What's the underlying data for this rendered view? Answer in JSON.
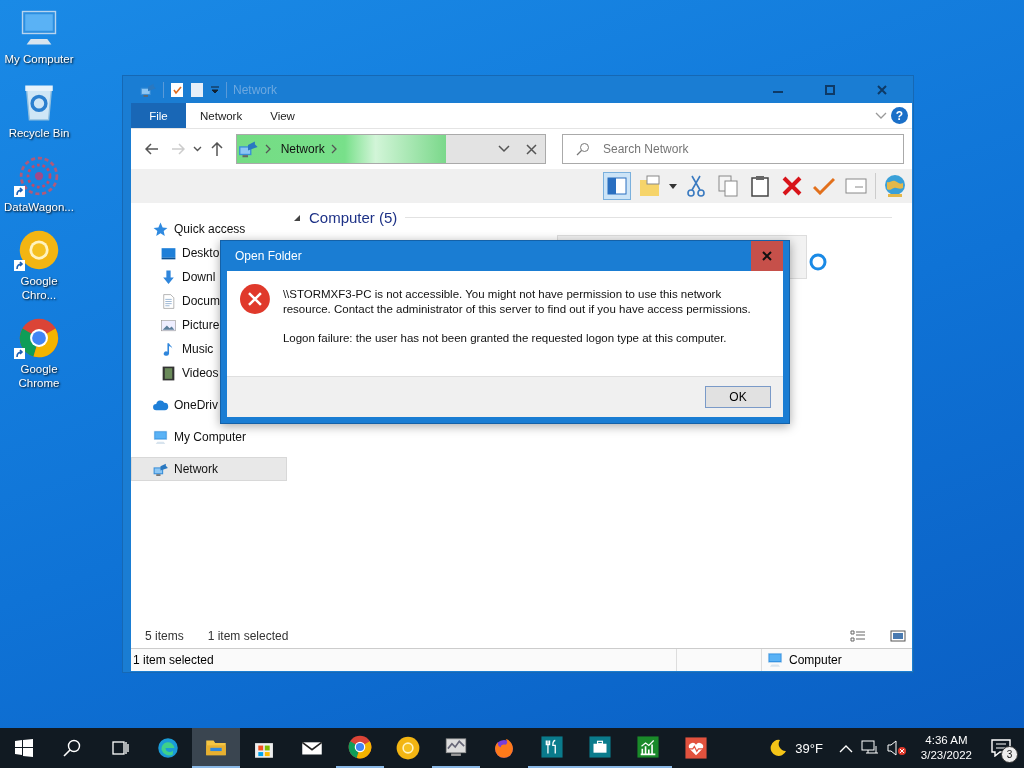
{
  "desktop_icons": [
    {
      "label": "My Computer",
      "kind": "computer",
      "shortcut": false
    },
    {
      "label": "Recycle Bin",
      "kind": "recycle",
      "shortcut": false
    },
    {
      "label": "DataWagon...",
      "kind": "datawagon",
      "shortcut": true
    },
    {
      "label": "Google Chro...",
      "kind": "canary",
      "shortcut": true
    },
    {
      "label": "Google Chrome",
      "kind": "chrome",
      "shortcut": true
    }
  ],
  "explorer": {
    "title": "Network",
    "ribbon": {
      "file": "File",
      "tabs": [
        "Network",
        "View"
      ],
      "help": "?"
    },
    "address": {
      "crumbs": [
        "Network"
      ]
    },
    "search": {
      "placeholder": "Search Network"
    },
    "nav": [
      {
        "label": "Quick access",
        "kind": "star",
        "selected": false,
        "children": [
          {
            "label": "Deskto",
            "kind": "desktop",
            "selected": false
          },
          {
            "label": "Downl",
            "kind": "download",
            "selected": false
          },
          {
            "label": "Docum",
            "kind": "document",
            "selected": false
          },
          {
            "label": "Picture",
            "kind": "picture",
            "selected": false
          },
          {
            "label": "Music",
            "kind": "music",
            "selected": false
          },
          {
            "label": "Videos",
            "kind": "video",
            "selected": false
          }
        ]
      },
      {
        "label": "OneDriv",
        "kind": "cloud",
        "selected": false
      },
      {
        "label": "My Computer",
        "kind": "computer",
        "selected": false
      },
      {
        "label": "Network",
        "kind": "network",
        "selected": true
      }
    ],
    "group": {
      "title": "Computer (5)",
      "expanded": true
    },
    "status": {
      "count": "5 items",
      "selection": "1 item selected"
    },
    "status_bar": {
      "left": "1 item selected",
      "right": "Computer"
    }
  },
  "dialog": {
    "title": "Open Folder",
    "message": "\\\\STORMXF3-PC is not accessible. You might not have permission to use this network resource. Contact the administrator of this server to find out if you have access permissions.",
    "detail": "Logon failure: the user has not been granted the requested logon type at this computer.",
    "button": "OK"
  },
  "taskbar": {
    "apps": [
      {
        "kind": "edge",
        "running": false,
        "selected": false
      },
      {
        "kind": "explorer",
        "running": true,
        "selected": true
      },
      {
        "kind": "store",
        "running": false,
        "selected": false
      },
      {
        "kind": "mail",
        "running": false,
        "selected": false
      },
      {
        "kind": "chrome",
        "running": true,
        "selected": false
      },
      {
        "kind": "canary",
        "running": false,
        "selected": false
      },
      {
        "kind": "monitor",
        "running": true,
        "selected": false
      },
      {
        "kind": "firefox",
        "running": false,
        "selected": false
      },
      {
        "kind": "utensils",
        "running": true,
        "selected": false
      },
      {
        "kind": "briefcase",
        "running": true,
        "selected": false
      },
      {
        "kind": "chart",
        "running": true,
        "selected": false
      },
      {
        "kind": "heart",
        "running": false,
        "selected": false
      }
    ],
    "weather": "39°F",
    "time": "4:36 AM",
    "date": "3/23/2022",
    "notifications": "3"
  }
}
